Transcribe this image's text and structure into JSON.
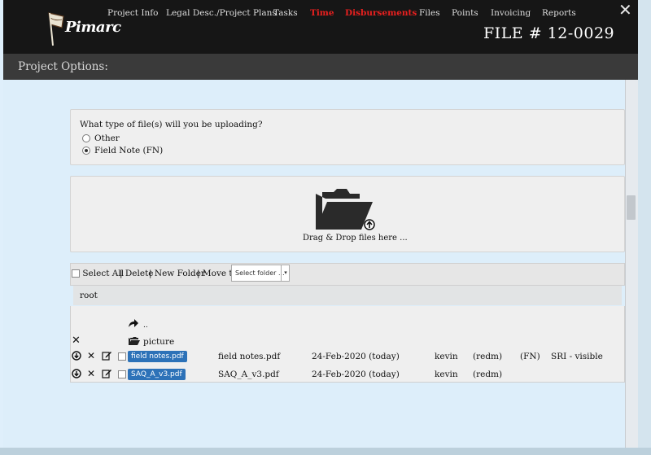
{
  "header": {
    "logo_text": "Pimarc",
    "file_number": "FILE # 12-0029",
    "close_symbol": "✕"
  },
  "nav": {
    "label": "Project Options:",
    "items": [
      {
        "label": "Project Info",
        "highlight": false
      },
      {
        "label": "Legal Desc./Project Plans",
        "highlight": false
      },
      {
        "label": "Tasks",
        "highlight": false
      },
      {
        "label": "Time",
        "highlight": true
      },
      {
        "label": "Disbursements",
        "highlight": true
      },
      {
        "label": "Files",
        "highlight": false
      },
      {
        "label": "Points",
        "highlight": false
      },
      {
        "label": "Invoicing",
        "highlight": false
      },
      {
        "label": "Reports",
        "highlight": false
      }
    ],
    "highlight_color": "#e8201f"
  },
  "upload": {
    "question": "What type of file(s) will you be uploading?",
    "options": [
      {
        "label": "Other",
        "selected": false
      },
      {
        "label": "Field Note (FN)",
        "selected": true
      }
    ],
    "drop_text": "Drag & Drop files here ..."
  },
  "toolbar": {
    "select_all": "Select All",
    "delete": "| Delete",
    "new_folder": "| New Folder",
    "move_to": "| Move to",
    "folder_select_placeholder": "Select folder ...",
    "folder_select_arrow": "▾"
  },
  "browser": {
    "path": "root",
    "up_label": "..",
    "folder_name": "picture",
    "files": [
      {
        "button": "field notes.pdf",
        "name": "field notes.pdf",
        "date": "24-Feb-2020 (today)",
        "user": "kevin",
        "role": "(redm)",
        "type": "(FN)",
        "note": "SRI - visible"
      },
      {
        "button": "SAQ_A_v3.pdf",
        "name": "SAQ_A_v3.pdf",
        "date": "24-Feb-2020 (today)",
        "user": "kevin",
        "role": "(redm)",
        "type": "",
        "note": ""
      }
    ]
  },
  "colors": {
    "header_bg": "#161616",
    "nav_bg": "#3a3a3a",
    "content_bg": "#ddeefa",
    "file_button": "#2d72b8"
  }
}
